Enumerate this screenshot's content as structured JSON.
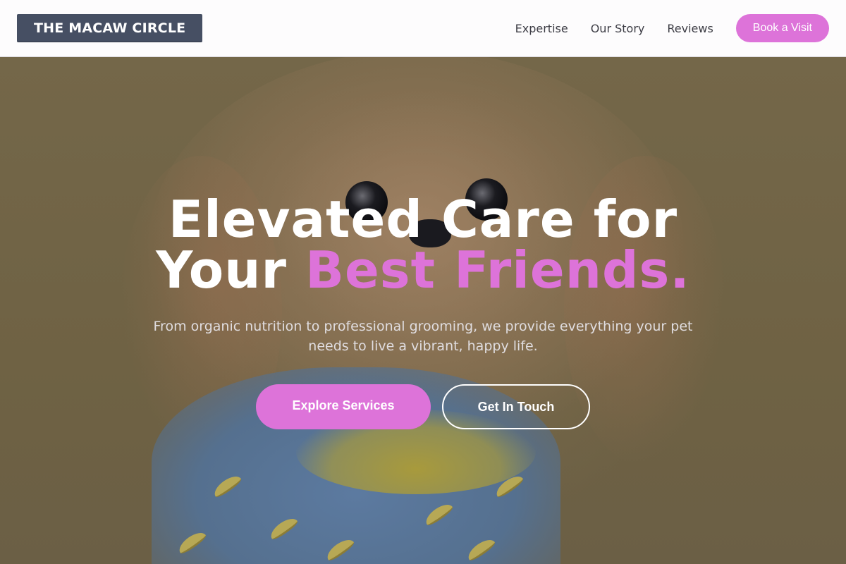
{
  "header": {
    "logo_text": "THE MACAW CIRCLE",
    "nav": [
      {
        "label": "Expertise"
      },
      {
        "label": "Our Story"
      },
      {
        "label": "Reviews"
      }
    ],
    "cta_label": "Book a Visit"
  },
  "hero": {
    "headline_line1": "Elevated Care for",
    "headline_line2_prefix": "Your ",
    "headline_line2_accent": "Best Friends.",
    "subtext": "From organic nutrition to professional grooming, we provide everything your pet needs to live a vibrant, happy life.",
    "primary_cta": "Explore Services",
    "secondary_cta": "Get In Touch",
    "background_image": "dog-photo"
  },
  "colors": {
    "accent": "#dd73d9",
    "logo_bg": "#464f63",
    "header_bg": "#fdfcfd",
    "hero_overlay": "#6f6448"
  }
}
